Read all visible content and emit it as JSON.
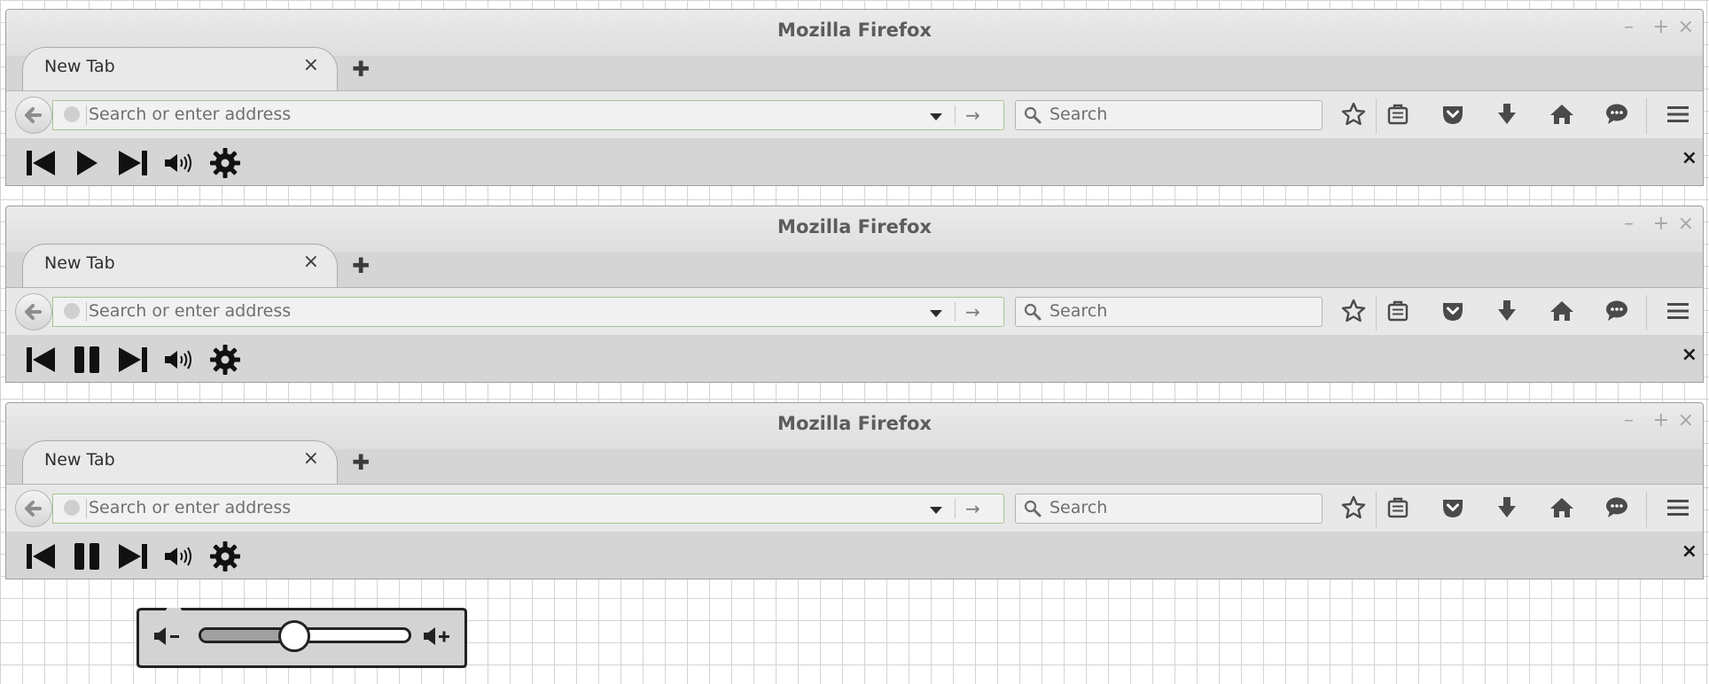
{
  "windows": [
    {
      "title": "Mozilla Firefox",
      "tab_label": "New Tab",
      "url_placeholder": "Search or enter address",
      "search_placeholder": "Search",
      "state": "play"
    },
    {
      "title": "Mozilla Firefox",
      "tab_label": "New Tab",
      "url_placeholder": "Search or enter address",
      "search_placeholder": "Search",
      "state": "pause"
    },
    {
      "title": "Mozilla Firefox",
      "tab_label": "New Tab",
      "url_placeholder": "Search or enter address",
      "search_placeholder": "Search",
      "state": "pause"
    }
  ],
  "window_controls": {
    "minimize": "–",
    "maximize": "+",
    "close": "×"
  },
  "tab_close": "×",
  "new_tab": "✚",
  "toolbar_icons": [
    "bookmark-star-icon",
    "reading-list-icon",
    "pocket-icon",
    "downloads-icon",
    "home-icon",
    "chat-icon",
    "menu-icon"
  ],
  "media_buttons": [
    "previous-track-icon",
    "play-pause-icon",
    "next-track-icon",
    "volume-icon",
    "settings-gear-icon"
  ],
  "media_close": "×",
  "volume_popup": {
    "level": 0.45
  },
  "colors": {
    "chrome": "#d5d5d5",
    "navbar": "#e8e8e8",
    "url_border": "#a7c58f",
    "icon": "#4a4a4a",
    "media_icon": "#111111"
  }
}
